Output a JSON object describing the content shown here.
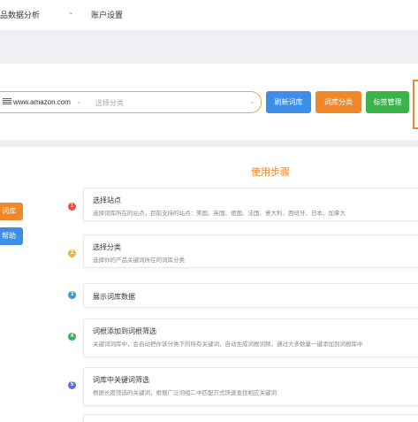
{
  "nav": {
    "analysis_label": "品数据分析",
    "analysis_chevron": "⌄",
    "account_label": "账户设置"
  },
  "toolbar": {
    "site_value": "www.amazon.com",
    "category_placeholder": "选择分类",
    "chevron": "⌄",
    "refresh_label": "刷新词库",
    "classify_label": "词库分类",
    "tags_label": "标签管理"
  },
  "sidebar": {
    "btn1_label": "词库",
    "btn2_label": "帮助"
  },
  "steps_title": "使用步骤",
  "steps": [
    {
      "num": "1",
      "title": "选择站点",
      "desc": "选择词库所在的站点，目前支持的站点：美国、英国、德国、法国、意大利、西班牙、日本、加拿大",
      "color": "#e74c3c"
    },
    {
      "num": "2",
      "title": "选择分类",
      "desc": "选择你的产品关键词所在的词库分类",
      "color": "#f5b133"
    },
    {
      "num": "3",
      "title": "展示词库数据",
      "desc": "",
      "color": "#2d9fd8"
    },
    {
      "num": "4",
      "title": "词根添加到词根筛选",
      "desc": "关键词词库中，会自动把你该分类下的所有关键词，自动生成词根词频，通过大多数量一键添加到词根库中",
      "color": "#3bb34a"
    },
    {
      "num": "5",
      "title": "词库中关键词筛选",
      "desc": "根据长度筛选的关键词，根据广泛词组二中匹配方式快速查找相应关键词",
      "color": "#5b6ee1"
    }
  ],
  "colors": {
    "accent_orange": "#f0872b",
    "primary_blue": "#3d8ee8",
    "success_green": "#3bb34a"
  }
}
